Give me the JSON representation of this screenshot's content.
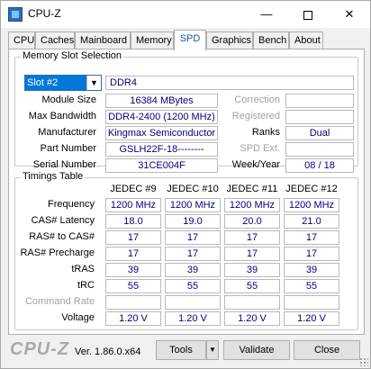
{
  "window": {
    "title": "CPU-Z",
    "minimize": "—",
    "close": "✕"
  },
  "tabs": [
    "CPU",
    "Caches",
    "Mainboard",
    "Memory",
    "SPD",
    "Graphics",
    "Bench",
    "About"
  ],
  "active_tab": "SPD",
  "memory_slot": {
    "group_label": "Memory Slot Selection",
    "slot_selected": "Slot #2",
    "type": "DDR4",
    "labels": {
      "module_size": "Module Size",
      "max_bandwidth": "Max Bandwidth",
      "manufacturer": "Manufacturer",
      "part_number": "Part Number",
      "serial_number": "Serial Number",
      "correction": "Correction",
      "registered": "Registered",
      "ranks": "Ranks",
      "spd_ext": "SPD Ext.",
      "week_year": "Week/Year"
    },
    "values": {
      "module_size": "16384 MBytes",
      "max_bandwidth": "DDR4-2400 (1200 MHz)",
      "manufacturer": "Kingmax Semiconductor",
      "part_number": "GSLH22F-18--------",
      "serial_number": "31CE004F",
      "ranks": "Dual",
      "week_year": "08 / 18"
    }
  },
  "timings": {
    "group_label": "Timings Table",
    "columns": [
      "JEDEC #9",
      "JEDEC #10",
      "JEDEC #11",
      "JEDEC #12"
    ],
    "rows": [
      {
        "label": "Frequency",
        "values": [
          "1200 MHz",
          "1200 MHz",
          "1200 MHz",
          "1200 MHz"
        ]
      },
      {
        "label": "CAS# Latency",
        "values": [
          "18.0",
          "19.0",
          "20.0",
          "21.0"
        ]
      },
      {
        "label": "RAS# to CAS#",
        "values": [
          "17",
          "17",
          "17",
          "17"
        ]
      },
      {
        "label": "RAS# Precharge",
        "values": [
          "17",
          "17",
          "17",
          "17"
        ]
      },
      {
        "label": "tRAS",
        "values": [
          "39",
          "39",
          "39",
          "39"
        ]
      },
      {
        "label": "tRC",
        "values": [
          "55",
          "55",
          "55",
          "55"
        ]
      },
      {
        "label": "Command Rate",
        "values": [
          "",
          "",
          "",
          ""
        ],
        "dim": true
      },
      {
        "label": "Voltage",
        "values": [
          "1.20 V",
          "1.20 V",
          "1.20 V",
          "1.20 V"
        ]
      }
    ]
  },
  "footer": {
    "logo": "CPU-Z",
    "version": "Ver. 1.86.0.x64",
    "tools": "Tools",
    "validate": "Validate",
    "close": "Close"
  }
}
